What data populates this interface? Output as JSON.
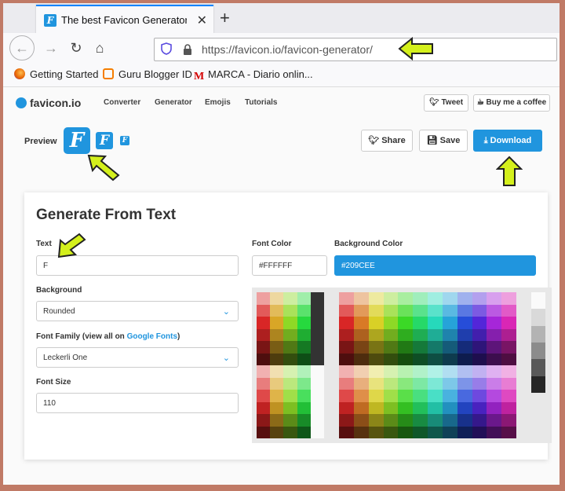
{
  "browser": {
    "tab_title": "The best Favicon Generator (co",
    "url": "https://favicon.io/favicon-generator/",
    "bookmarks": [
      "Getting Started",
      "Guru Blogger ID",
      "MARCA - Diario onlin..."
    ]
  },
  "site": {
    "logo": "favicon.io",
    "nav": [
      "Converter",
      "Generator",
      "Emojis",
      "Tutorials"
    ],
    "tweet_label": "Tweet",
    "coffee_label": "Buy me a coffee"
  },
  "preview": {
    "label": "Preview",
    "letter": "F",
    "share_label": "Share",
    "save_label": "Save",
    "download_label": "Download"
  },
  "form": {
    "title": "Generate From Text",
    "text_label": "Text",
    "text_value": "F",
    "background_label": "Background",
    "background_value": "Rounded",
    "font_family_label": "Font Family (view all on ",
    "font_family_link": "Google Fonts",
    "font_family_close": ")",
    "font_family_value": "Leckerli One",
    "font_size_label": "Font Size",
    "font_size_value": "110",
    "font_color_label": "Font Color",
    "font_color_value": "#FFFFFF",
    "bg_color_label": "Background Color",
    "bg_color_value": "#209CEE"
  },
  "colors": {
    "accent": "#2095de",
    "highlight_arrow": "#d4f01c"
  }
}
